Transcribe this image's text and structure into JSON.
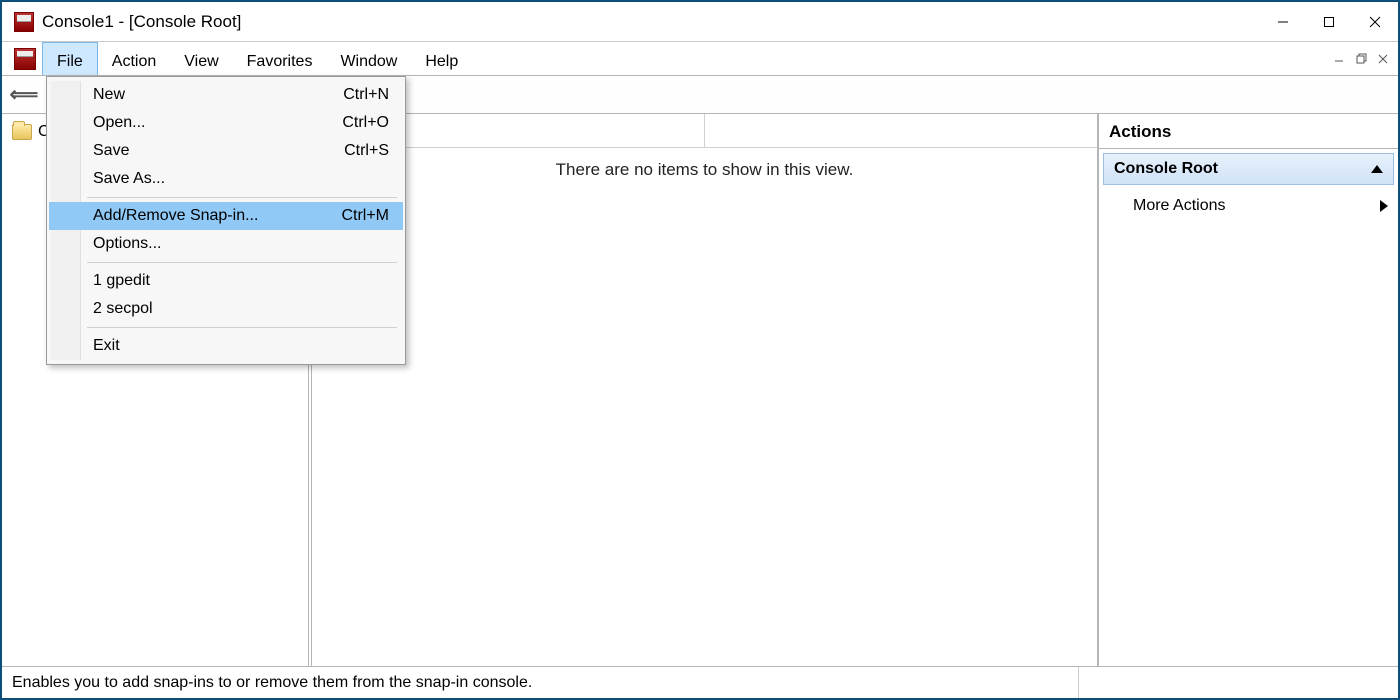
{
  "window": {
    "title": "Console1 - [Console Root]"
  },
  "menubar": {
    "items": [
      "File",
      "Action",
      "View",
      "Favorites",
      "Window",
      "Help"
    ],
    "open_index": 0
  },
  "file_menu": {
    "items": [
      {
        "label": "New",
        "shortcut": "Ctrl+N",
        "highlighted": false
      },
      {
        "label": "Open...",
        "shortcut": "Ctrl+O",
        "highlighted": false
      },
      {
        "label": "Save",
        "shortcut": "Ctrl+S",
        "highlighted": false
      },
      {
        "label": "Save As...",
        "shortcut": "",
        "highlighted": false
      },
      {
        "separator": true
      },
      {
        "label": "Add/Remove Snap-in...",
        "shortcut": "Ctrl+M",
        "highlighted": true
      },
      {
        "label": "Options...",
        "shortcut": "",
        "highlighted": false
      },
      {
        "separator": true
      },
      {
        "label": "1 gpedit",
        "shortcut": "",
        "highlighted": false
      },
      {
        "label": "2 secpol",
        "shortcut": "",
        "highlighted": false
      },
      {
        "separator": true
      },
      {
        "label": "Exit",
        "shortcut": "",
        "highlighted": false
      }
    ]
  },
  "tree": {
    "root_label": "Console Root"
  },
  "content": {
    "empty_message": "There are no items to show in this view."
  },
  "actions": {
    "pane_title": "Actions",
    "section_label": "Console Root",
    "more_label": "More Actions"
  },
  "statusbar": {
    "text": "Enables you to add snap-ins to or remove them from the snap-in console."
  }
}
